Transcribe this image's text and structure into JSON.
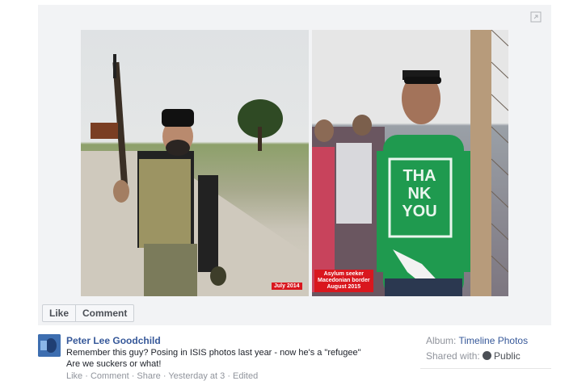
{
  "photo": {
    "left_caption": "July 2014",
    "right_caption_lines": [
      "Asylum seeker",
      "Macedonian border",
      "August 2015"
    ],
    "shirt_text": [
      "THA",
      "NK",
      "YOU"
    ]
  },
  "buttons": {
    "like_label": "Like",
    "comment_label": "Comment"
  },
  "post": {
    "author": "Peter Lee Goodchild",
    "line1": "Remember this guy? Posing in ISIS photos last year - now he's a \"refugee\"",
    "line2": "Are we suckers or what!",
    "actions_line": "Like · Comment · Share · Yesterday at 3 · Edited"
  },
  "meta": {
    "album_label": "Album:",
    "album_value": "Timeline Photos",
    "shared_label": "Shared with:",
    "shared_value": "Public"
  },
  "colors": {
    "caption_red": "#d9171e",
    "link_blue": "#365899",
    "shirt_green": "#1f9a4f"
  }
}
